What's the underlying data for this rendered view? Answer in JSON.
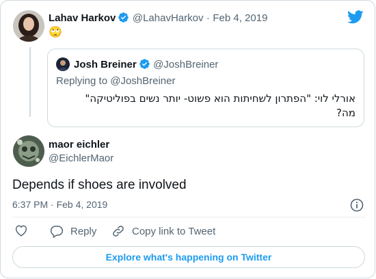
{
  "parent_tweet": {
    "author_name": "Lahav Harkov",
    "author_handle": "@LahavHarkov",
    "separator": "·",
    "date": "Feb 4, 2019",
    "emoji": "🙄"
  },
  "quoted_tweet": {
    "author_name": "Josh Breiner",
    "author_handle": "@JoshBreiner",
    "replying_to": "Replying to @JoshBreiner",
    "text_line1": "אורלי לוי: \"הפתרון לשחיתות הוא פשוט- יותר נשים בפוליטיקה\"",
    "text_line2": "מה?"
  },
  "main_tweet": {
    "author_name": "maor eichler",
    "author_handle": "@EichlerMaor",
    "text": "Depends if shoes are involved",
    "time": "6:37 PM",
    "separator": "·",
    "date": "Feb 4, 2019"
  },
  "actions": {
    "reply_label": "Reply",
    "copy_link_label": "Copy link to Tweet"
  },
  "explore_label": "Explore what's happening on Twitter",
  "colors": {
    "accent": "#1d9bf0",
    "secondary_text": "#536471",
    "border": "#cfd9de"
  }
}
